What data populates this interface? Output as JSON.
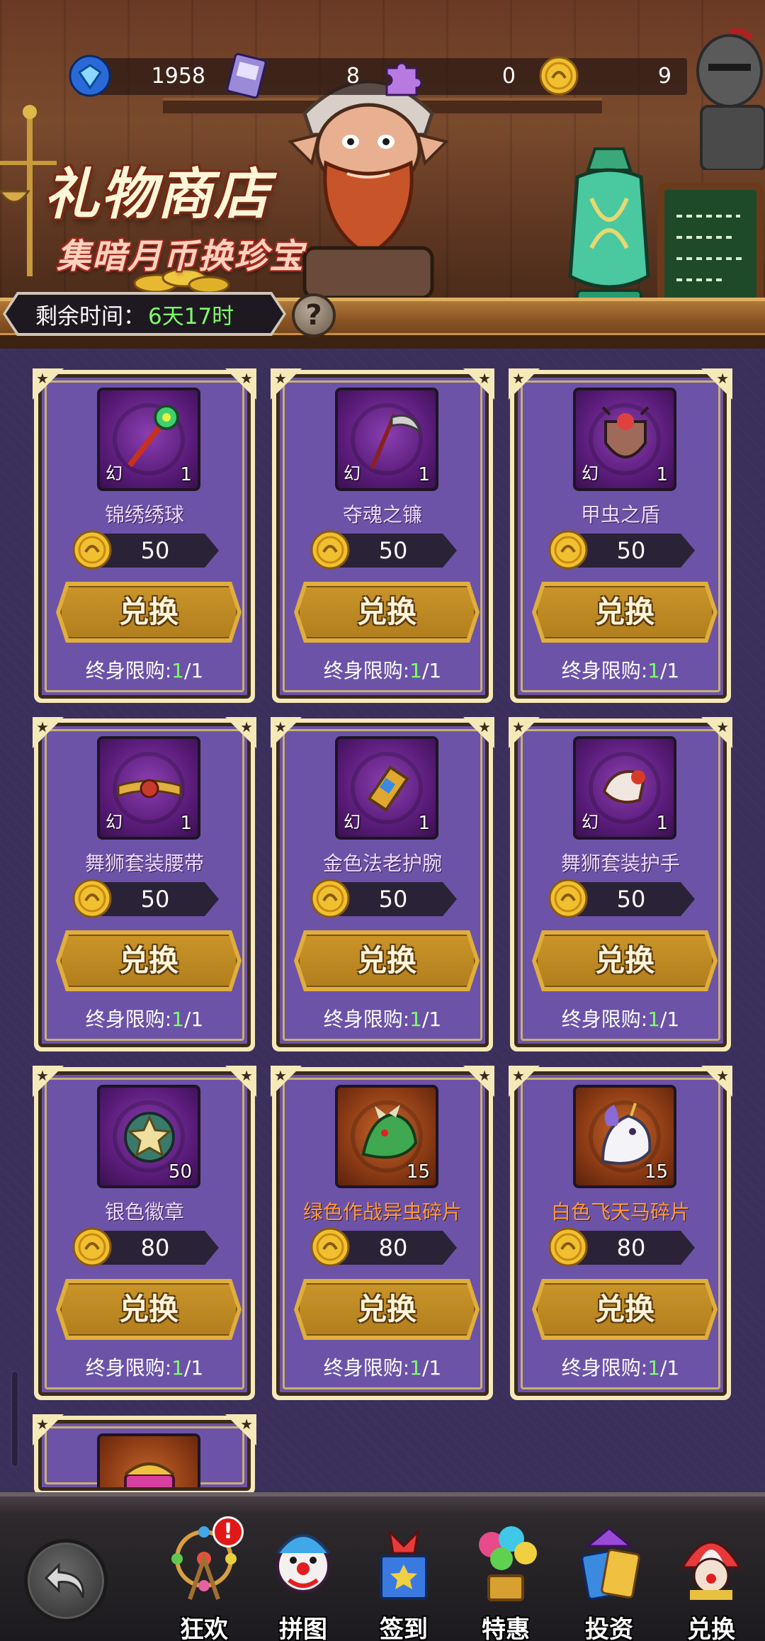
{
  "resources": [
    {
      "icon": "blue-gem-icon",
      "value": "1958"
    },
    {
      "icon": "card-ticket-icon",
      "value": "8"
    },
    {
      "icon": "puzzle-piece-icon",
      "value": "0"
    },
    {
      "icon": "gold-moon-coin-icon",
      "value": "9"
    }
  ],
  "header": {
    "title": "礼物商店",
    "subtitle": "集暗月币换珍宝",
    "timer_label": "剩余时间：",
    "timer_value": "6天17时",
    "help": "?"
  },
  "shop": {
    "badge_text": "幻",
    "button_label": "兑换",
    "limit_label": "终身限购:",
    "items": [
      {
        "name": "锦绣绣球",
        "qty": "1",
        "price": "50",
        "limit_current": "1",
        "limit_total": "/1",
        "rarity": "purple",
        "icon": "staff-icon",
        "show_tag": true
      },
      {
        "name": "夺魂之镰",
        "qty": "1",
        "price": "50",
        "limit_current": "1",
        "limit_total": "/1",
        "rarity": "purple",
        "icon": "scythe-icon",
        "show_tag": true
      },
      {
        "name": "甲虫之盾",
        "qty": "1",
        "price": "50",
        "limit_current": "1",
        "limit_total": "/1",
        "rarity": "purple",
        "icon": "beetle-shield-icon",
        "show_tag": true
      },
      {
        "name": "舞狮套装腰带",
        "qty": "1",
        "price": "50",
        "limit_current": "1",
        "limit_total": "/1",
        "rarity": "purple",
        "icon": "belt-icon",
        "show_tag": true
      },
      {
        "name": "金色法老护腕",
        "qty": "1",
        "price": "50",
        "limit_current": "1",
        "limit_total": "/1",
        "rarity": "purple",
        "icon": "bracer-icon",
        "show_tag": true
      },
      {
        "name": "舞狮套装护手",
        "qty": "1",
        "price": "50",
        "limit_current": "1",
        "limit_total": "/1",
        "rarity": "purple",
        "icon": "gauntlet-icon",
        "show_tag": true
      },
      {
        "name": "银色徽章",
        "qty": "50",
        "price": "80",
        "limit_current": "1",
        "limit_total": "/1",
        "rarity": "purple",
        "icon": "silver-badge-icon",
        "show_tag": false
      },
      {
        "name": "绿色作战异虫碎片",
        "qty": "15",
        "price": "80",
        "limit_current": "1",
        "limit_total": "/1",
        "rarity": "orange",
        "icon": "green-beast-shard-icon",
        "show_tag": false
      },
      {
        "name": "白色飞天马碎片",
        "qty": "15",
        "price": "80",
        "limit_current": "1",
        "limit_total": "/1",
        "rarity": "orange",
        "icon": "white-pegasus-shard-icon",
        "show_tag": false
      }
    ]
  },
  "nav": {
    "items": [
      {
        "label": "狂欢",
        "icon": "ferris-wheel-icon",
        "badge": "!"
      },
      {
        "label": "拼图",
        "icon": "clown-icon"
      },
      {
        "label": "签到",
        "icon": "jack-in-box-icon"
      },
      {
        "label": "特惠",
        "icon": "balloons-icon"
      },
      {
        "label": "投资",
        "icon": "jester-cards-icon"
      },
      {
        "label": "兑换",
        "icon": "circus-clown-icon"
      }
    ]
  },
  "colors": {
    "accent_green": "#7dff6a",
    "card_purple": "#6c53a8",
    "button_gold": "#c99428",
    "rarity_orange": "#ff9a3a"
  }
}
